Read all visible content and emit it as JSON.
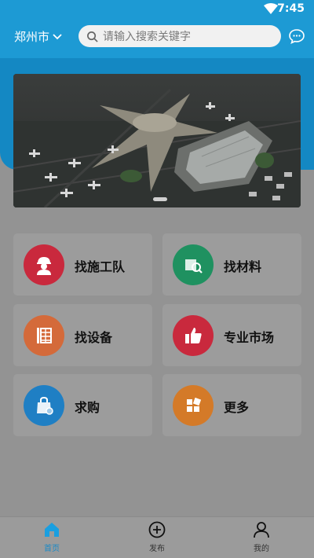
{
  "status_bar": {
    "time": "7:45"
  },
  "header": {
    "city": "郑州市",
    "search_placeholder": "请输入搜索关键字"
  },
  "categories": [
    {
      "label": "找施工队",
      "icon": "worker-icon",
      "color": "#c9293d"
    },
    {
      "label": "找材料",
      "icon": "materials-search-icon",
      "color": "#1f9160"
    },
    {
      "label": "找设备",
      "icon": "equipment-icon",
      "color": "#d46a3a"
    },
    {
      "label": "专业市场",
      "icon": "thumbs-up-icon",
      "color": "#c9293d"
    },
    {
      "label": "求购",
      "icon": "shopping-bag-icon",
      "color": "#1f7fc4"
    },
    {
      "label": "更多",
      "icon": "more-grid-icon",
      "color": "#d47a28"
    }
  ],
  "tabbar": {
    "tabs": [
      {
        "label": "首页",
        "icon": "home-icon",
        "active": true
      },
      {
        "label": "发布",
        "icon": "plus-circle-icon",
        "active": false
      },
      {
        "label": "我的",
        "icon": "user-icon",
        "active": false
      }
    ]
  }
}
